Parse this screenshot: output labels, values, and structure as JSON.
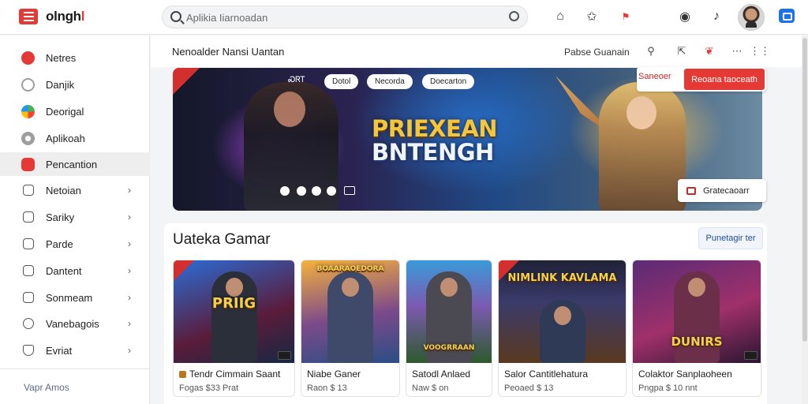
{
  "app": {
    "brand_part1": "olngh",
    "brand_part2": "l"
  },
  "search": {
    "placeholder": "Aplikia Iiarnoadan"
  },
  "sidebar": {
    "items": [
      {
        "label": "Netres",
        "icon": "youtube-play-icon",
        "color": "#e53935",
        "chevron": false
      },
      {
        "label": "Danjik",
        "icon": "gear-icon",
        "color": "#9e9e9e",
        "chevron": false
      },
      {
        "label": "Deorigal",
        "icon": "color-globe-icon",
        "color": "#4caf50",
        "chevron": false
      },
      {
        "label": "Aplikoah",
        "icon": "disc-icon",
        "color": "#9e9e9e",
        "chevron": false
      },
      {
        "label": "Pencantion",
        "icon": "red-badge-icon",
        "color": "#e53935",
        "chevron": false,
        "active": true
      },
      {
        "label": "Netoian",
        "icon": "chart-box-icon",
        "color": "#555",
        "chevron": true
      },
      {
        "label": "Sariky",
        "icon": "briefcase-icon",
        "color": "#555",
        "chevron": true
      },
      {
        "label": "Parde",
        "icon": "document-icon",
        "color": "#555",
        "chevron": true
      },
      {
        "label": "Dantent",
        "icon": "edit-icon",
        "color": "#555",
        "chevron": true
      },
      {
        "label": "Sonmeam",
        "icon": "stats-icon",
        "color": "#555",
        "chevron": true
      },
      {
        "label": "Vanebagois",
        "icon": "check-circle-icon",
        "color": "#555",
        "chevron": true
      },
      {
        "label": "Evriat",
        "icon": "shield-icon",
        "color": "#555",
        "chevron": true
      }
    ],
    "chevron_glyph": "›",
    "footer": "Vapr Amos"
  },
  "main": {
    "title": "Nenoalder Nansi Uantan",
    "header_link": "Pabse Guanain"
  },
  "banner": {
    "chip_dark": "ᏍᏒᎢ",
    "chips": [
      "Dotol",
      "Necorda",
      "Doecarton"
    ],
    "title_line1": "PRIEXEAN",
    "title_line2": "BNTENGH",
    "cta_outline": "Saneoer",
    "cta_solid": "Reoana taoceath",
    "float_button": "Gratecaoarr",
    "slide_count": 4
  },
  "section": {
    "title": "Uateka Gamar",
    "button": "Punetagir ter"
  },
  "cards": [
    {
      "name": "Tendr Cimmain Saant",
      "meta": "Fogas $33 Prat",
      "art_text": "PRIIG",
      "top_color": "#2b6cd6",
      "bottom_color": "#162844",
      "figure_color": "#2a2f3a",
      "mini_color": "#b7791f"
    },
    {
      "name": "Niabe Ganer",
      "meta": "Raon $ 13",
      "art_text": "BOAARAOEDORA",
      "top_color": "#f5b13d",
      "bottom_color": "#2b4e85",
      "figure_color": "#3f4a6a",
      "mini_color": null
    },
    {
      "name": "Satodl Anlaed",
      "meta": "Naw $ on",
      "art_text": "VOOGRRAAN",
      "top_color": "#3a9ad9",
      "bottom_color": "#2d5a2c",
      "figure_color": "#4b4a52",
      "mini_color": "#e53935"
    },
    {
      "name": "Salor Cantitlehatura",
      "meta": "Peoaed $ 13",
      "art_text": "NIMLINK KAVLAMA",
      "top_color": "#1f2236",
      "bottom_color": "#5a3a20",
      "figure_color": "#2e3a56",
      "mini_color": null
    },
    {
      "name": "Colaktor Sanplaoheen",
      "meta": "Pngpa $ 10 nnt",
      "art_text": "DUNIRS",
      "top_color": "#5a2b76",
      "bottom_color": "#2a1630",
      "figure_color": "#6b2f4a",
      "mini_color": null
    }
  ]
}
